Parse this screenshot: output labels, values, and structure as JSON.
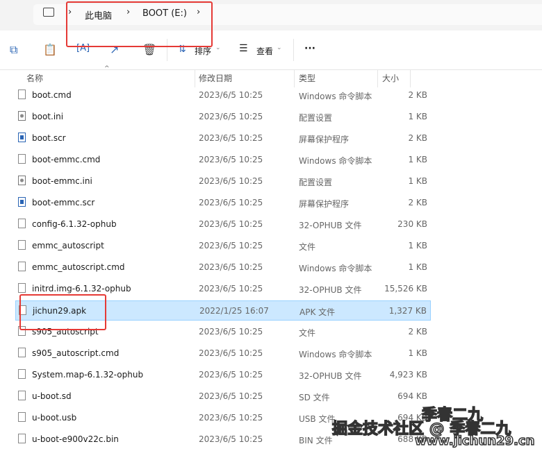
{
  "breadcrumb": {
    "items": [
      "此电脑",
      "BOOT (E:)"
    ]
  },
  "toolbar": {
    "sort_label": "排序",
    "view_label": "查看",
    "more_label": "···"
  },
  "columns": {
    "name": "名称",
    "modified": "修改日期",
    "type": "类型",
    "size": "大小"
  },
  "files": [
    {
      "name": "boot.cmd",
      "date": "2023/6/5 10:25",
      "type": "Windows 命令脚本",
      "size": "2 KB",
      "icon": "cmd"
    },
    {
      "name": "boot.ini",
      "date": "2023/6/5 10:25",
      "type": "配置设置",
      "size": "1 KB",
      "icon": "cfg"
    },
    {
      "name": "boot.scr",
      "date": "2023/6/5 10:25",
      "type": "屏幕保护程序",
      "size": "2 KB",
      "icon": "scr"
    },
    {
      "name": "boot-emmc.cmd",
      "date": "2023/6/5 10:25",
      "type": "Windows 命令脚本",
      "size": "1 KB",
      "icon": "cmd"
    },
    {
      "name": "boot-emmc.ini",
      "date": "2023/6/5 10:25",
      "type": "配置设置",
      "size": "1 KB",
      "icon": "cfg"
    },
    {
      "name": "boot-emmc.scr",
      "date": "2023/6/5 10:25",
      "type": "屏幕保护程序",
      "size": "2 KB",
      "icon": "scr"
    },
    {
      "name": "config-6.1.32-ophub",
      "date": "2023/6/5 10:25",
      "type": "32-OPHUB 文件",
      "size": "230 KB",
      "icon": "file"
    },
    {
      "name": "emmc_autoscript",
      "date": "2023/6/5 10:25",
      "type": "文件",
      "size": "1 KB",
      "icon": "file"
    },
    {
      "name": "emmc_autoscript.cmd",
      "date": "2023/6/5 10:25",
      "type": "Windows 命令脚本",
      "size": "1 KB",
      "icon": "cmd"
    },
    {
      "name": "initrd.img-6.1.32-ophub",
      "date": "2023/6/5 10:25",
      "type": "32-OPHUB 文件",
      "size": "15,526 KB",
      "icon": "file"
    },
    {
      "name": "jichun29.apk",
      "date": "2022/1/25 16:07",
      "type": "APK 文件",
      "size": "1,327 KB",
      "icon": "file",
      "selected": true
    },
    {
      "name": "s905_autoscript",
      "date": "2023/6/5 10:25",
      "type": "文件",
      "size": "2 KB",
      "icon": "file"
    },
    {
      "name": "s905_autoscript.cmd",
      "date": "2023/6/5 10:25",
      "type": "Windows 命令脚本",
      "size": "1 KB",
      "icon": "cmd"
    },
    {
      "name": "System.map-6.1.32-ophub",
      "date": "2023/6/5 10:25",
      "type": "32-OPHUB 文件",
      "size": "4,923 KB",
      "icon": "file"
    },
    {
      "name": "u-boot.sd",
      "date": "2023/6/5 10:25",
      "type": "SD 文件",
      "size": "694 KB",
      "icon": "file"
    },
    {
      "name": "u-boot.usb",
      "date": "2023/6/5 10:25",
      "type": "USB 文件",
      "size": "694 KB",
      "icon": "file"
    },
    {
      "name": "u-boot-e900v22c.bin",
      "date": "2023/6/5 10:25",
      "type": "BIN 文件",
      "size": "688 KB",
      "icon": "file"
    }
  ],
  "watermark": {
    "line1": "季春二九",
    "line2": "掘金技术社区 @ 季春二九",
    "line3": "www.jichun29.cn"
  }
}
